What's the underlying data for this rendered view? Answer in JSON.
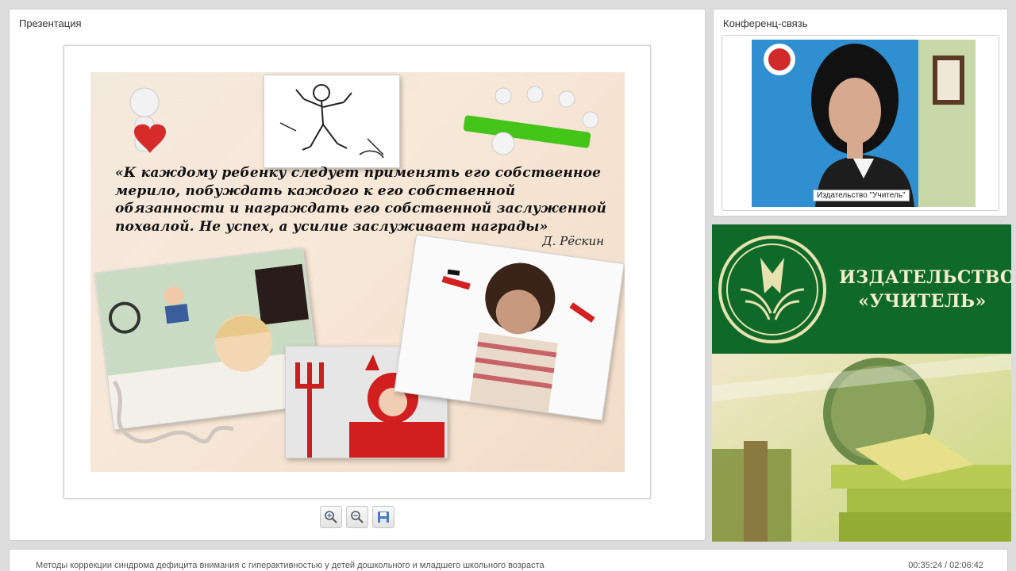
{
  "presentation": {
    "title": "Презентация",
    "slide": {
      "quote": "«К каждому ребенку следует применять его собственное мерило, побуждать каждого к его собственной обязанности и награждать его собственной заслуженной похвалой. Не успех, а усилие заслуживает награды»",
      "author": "Д. Рёскин"
    },
    "toolbar": {
      "zoom_in": "zoom-in-icon",
      "zoom_out": "zoom-out-icon",
      "save": "save-icon"
    }
  },
  "conference": {
    "title": "Конференц-связь",
    "speaker_caption": "Издательство \"Учитель\""
  },
  "publisher": {
    "name_line1": "ИЗДАТЕЛЬСТВО",
    "name_line2": "«УЧИТЕЛЬ»"
  },
  "footer": {
    "lecture_title": "Методы коррекции синдрома дефицита внимания с гиперактивностью у детей дошкольного и младшего школьного возраста",
    "time": "00:35:24 / 02:06:42"
  },
  "colors": {
    "brand_green": "#0f6a2a",
    "brand_cream": "#f4eecb"
  }
}
